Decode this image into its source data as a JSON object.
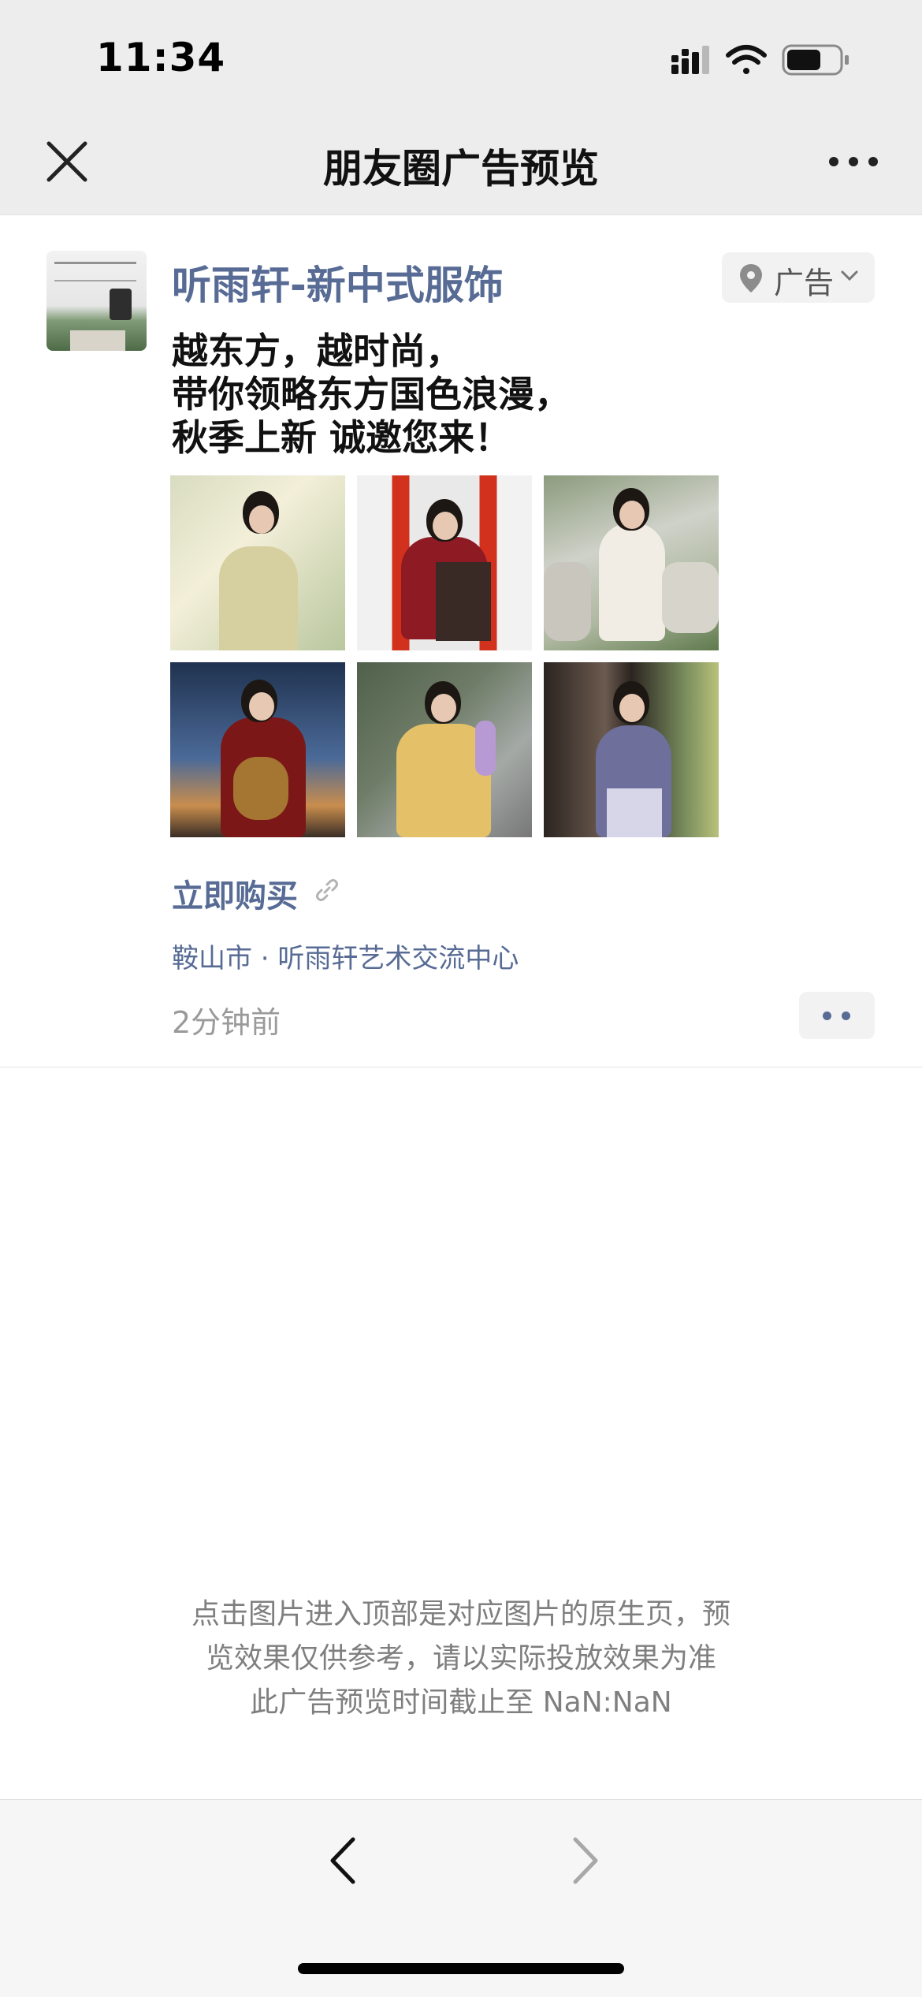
{
  "status_bar": {
    "time": "11:34"
  },
  "nav": {
    "title": "朋友圈广告预览"
  },
  "post": {
    "author": "听雨轩-新中式服饰",
    "ad_label": "广告",
    "text_lines": [
      "越东方，越时尚，",
      "带你领略东方国色浪漫，",
      "秋季上新 诚邀您来！"
    ],
    "photo_count": 6,
    "cta": "立即购买",
    "location": "鞍山市 · 听雨轩艺术交流中心",
    "time_ago": "2分钟前"
  },
  "notice": {
    "lines": [
      "点击图片进入顶部是对应图片的原生页，预",
      "览效果仅供参考，请以实际投放效果为准",
      "此广告预览时间截止至 NaN:NaN"
    ]
  },
  "icons": {
    "close": "close-icon",
    "more": "more-icon",
    "location": "location-pin-icon",
    "link": "link-icon",
    "back": "chevron-left-icon",
    "forward": "chevron-right-icon"
  },
  "colors": {
    "link_blue": "#576b95",
    "nav_bg": "#ededed",
    "secondary_text": "#9a9a9a"
  }
}
